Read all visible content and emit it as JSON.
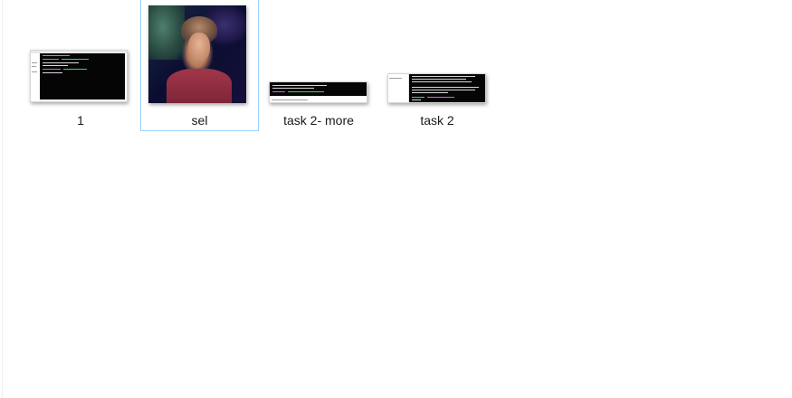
{
  "files": [
    {
      "name": "1",
      "type": "screenshot-thumbnail",
      "selected": false
    },
    {
      "name": "sel",
      "type": "photo-thumbnail",
      "selected": true
    },
    {
      "name": "task 2- more",
      "type": "screenshot-thumbnail",
      "selected": false
    },
    {
      "name": "task 2",
      "type": "screenshot-thumbnail",
      "selected": false
    }
  ],
  "colors": {
    "selection_border": "#99d1ff",
    "terminal_bg": "#050505",
    "terminal_green": "#3fd46a",
    "terminal_purple": "#c070d0",
    "terminal_white": "#d8d8d8"
  }
}
